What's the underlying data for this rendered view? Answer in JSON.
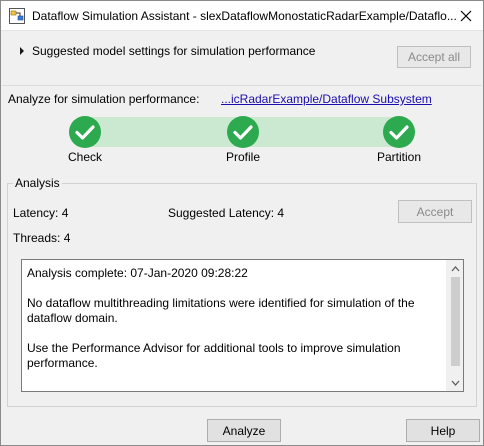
{
  "window": {
    "title": "Dataflow Simulation Assistant - slexDataflowMonostaticRadarExample/Dataflo..."
  },
  "settings": {
    "label": "Suggested model settings for simulation performance",
    "accept_all_label": "Accept all"
  },
  "analyze_for": {
    "label": "Analyze for simulation performance:",
    "link": "...icRadarExample/Dataflow Subsystem"
  },
  "steps": [
    {
      "label": "Check",
      "status": "complete"
    },
    {
      "label": "Profile",
      "status": "complete"
    },
    {
      "label": "Partition",
      "status": "complete"
    }
  ],
  "analysis": {
    "group_label": "Analysis",
    "latency": "Latency: 4",
    "suggested_latency": "Suggested Latency: 4",
    "threads": "Threads: 4",
    "accept_label": "Accept",
    "report": {
      "line1": "Analysis complete: 07-Jan-2020 09:28:22",
      "line2": "No dataflow multithreading limitations were identified for simulation of the dataflow domain.",
      "line3": "Use the Performance Advisor for additional tools to improve simulation performance."
    }
  },
  "footer": {
    "analyze_label": "Analyze",
    "help_label": "Help"
  },
  "colors": {
    "step_complete": "#2da94f",
    "step_track": "#cbe8d0",
    "link": "#1a0dab"
  },
  "icons": {
    "app": "simulink-app-icon",
    "close": "close-icon",
    "expand": "chevron-right-icon",
    "step": "checkmark-circle-icon"
  }
}
